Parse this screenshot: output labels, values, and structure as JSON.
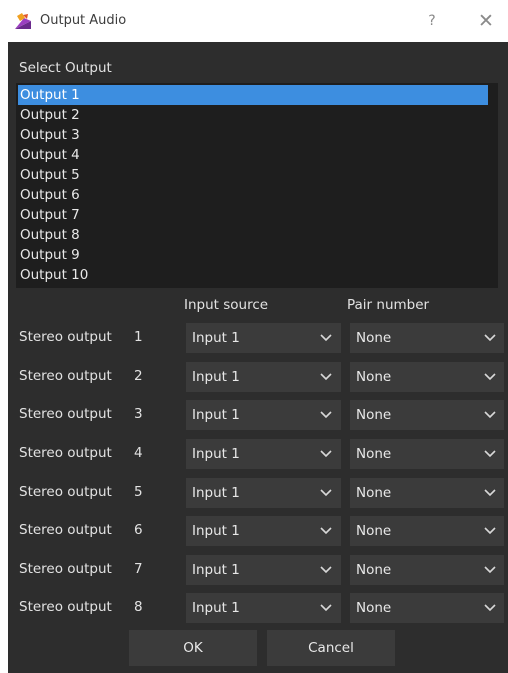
{
  "window": {
    "title": "Output Audio",
    "help_glyph": "?",
    "close_glyph": "✕"
  },
  "select_output": {
    "label": "Select Output",
    "items": [
      "Output 1",
      "Output 2",
      "Output 3",
      "Output 4",
      "Output 5",
      "Output 6",
      "Output 7",
      "Output 8",
      "Output 9",
      "Output 10"
    ],
    "selected_index": 0
  },
  "columns": {
    "input_source": "Input source",
    "pair_number": "Pair number"
  },
  "stereo_label": "Stereo output",
  "rows": [
    {
      "number": "1",
      "input_source": "Input 1",
      "pair_number": "None"
    },
    {
      "number": "2",
      "input_source": "Input 1",
      "pair_number": "None"
    },
    {
      "number": "3",
      "input_source": "Input 1",
      "pair_number": "None"
    },
    {
      "number": "4",
      "input_source": "Input 1",
      "pair_number": "None"
    },
    {
      "number": "5",
      "input_source": "Input 1",
      "pair_number": "None"
    },
    {
      "number": "6",
      "input_source": "Input 1",
      "pair_number": "None"
    },
    {
      "number": "7",
      "input_source": "Input 1",
      "pair_number": "None"
    },
    {
      "number": "8",
      "input_source": "Input 1",
      "pair_number": "None"
    }
  ],
  "buttons": {
    "ok": "OK",
    "cancel": "Cancel"
  },
  "colors": {
    "dialog_bg": "#2d2d2d",
    "list_bg": "#1e1e1e",
    "selection": "#3d8ee0",
    "combo_bg": "#3b3b3b",
    "text": "#e2e2e2",
    "title_bar_bg": "#ffffff"
  },
  "icons": {
    "app_icon": "app-icon",
    "help": "help-icon",
    "close": "close-icon",
    "dropdown": "chevron-down-icon"
  }
}
